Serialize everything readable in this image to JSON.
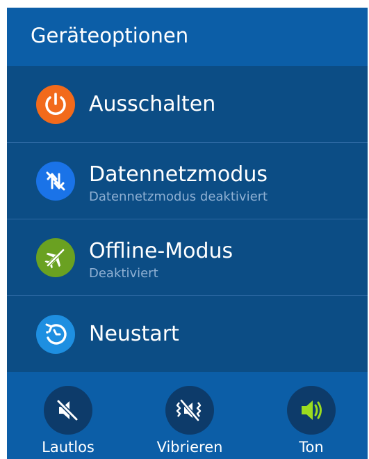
{
  "header": {
    "title": "Geräteoptionen"
  },
  "colors": {
    "header_bg": "#0c5ea7",
    "list_bg": "#0c4d85",
    "power_icon": "#f26a1b",
    "data_icon": "#1a73e8",
    "offline_icon": "#6aa121",
    "restart_icon": "#1e8fe1",
    "sound_active": "#9bdc1f"
  },
  "menu": {
    "items": [
      {
        "label": "Ausschalten",
        "icon": "power-icon"
      },
      {
        "label": "Datennetzmodus",
        "sublabel": "Datennetzmodus deaktiviert",
        "icon": "data-network-off-icon"
      },
      {
        "label": "Offline-Modus",
        "sublabel": "Deaktiviert",
        "icon": "airplane-off-icon"
      },
      {
        "label": "Neustart",
        "icon": "restart-icon"
      }
    ]
  },
  "sound_modes": {
    "selected": "Ton",
    "items": [
      {
        "label": "Lautlos",
        "icon": "mute-icon"
      },
      {
        "label": "Vibrieren",
        "icon": "vibrate-icon"
      },
      {
        "label": "Ton",
        "icon": "sound-on-icon"
      }
    ]
  }
}
